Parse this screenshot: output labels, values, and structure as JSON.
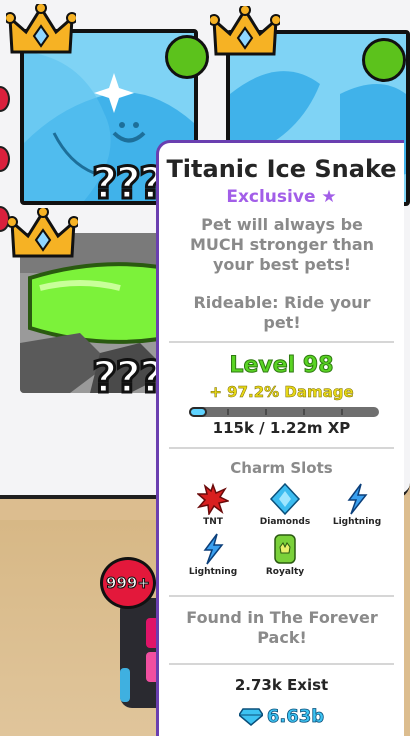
{
  "inventory": {
    "cards": [
      {
        "name": "ice-snake-card",
        "question_marks": "???"
      },
      {
        "name": "ice-pet-card",
        "question_marks": ""
      },
      {
        "name": "goggles-pet-card",
        "question_marks": "???"
      }
    ],
    "badge_count": "999+"
  },
  "tooltip": {
    "title": "Titanic Ice Snake",
    "rarity": "Exclusive",
    "rarity_icon": "star-icon",
    "description": "Pet will always be MUCH stronger than your best pets!",
    "rideable": "Rideable: Ride your pet!",
    "level": "Level 98",
    "damage": "+ 97.2% Damage",
    "xp_text": "115k / 1.22m XP",
    "xp_progress": 0.094,
    "charm_slots_title": "Charm Slots",
    "charms": [
      {
        "label": "TNT",
        "icon": "tnt-icon",
        "color": "#d91f1f"
      },
      {
        "label": "Diamonds",
        "icon": "diamond-icon",
        "color": "#3cbcf0"
      },
      {
        "label": "Lightning",
        "icon": "lightning-icon",
        "color": "#3aa0f0"
      },
      {
        "label": "Lightning",
        "icon": "lightning-icon",
        "color": "#3aa0f0"
      },
      {
        "label": "Royalty",
        "icon": "royalty-icon",
        "color": "#7ad13a"
      }
    ],
    "found_in": "Found in The Forever Pack!",
    "exist": "2.73k Exist",
    "price": "6.63b",
    "price_icon": "gem-icon"
  },
  "colors": {
    "accent_purple": "#a25ee8",
    "level_green": "#5ad424",
    "damage_yellow": "#e8d817",
    "gem_blue": "#3dc3f2"
  }
}
